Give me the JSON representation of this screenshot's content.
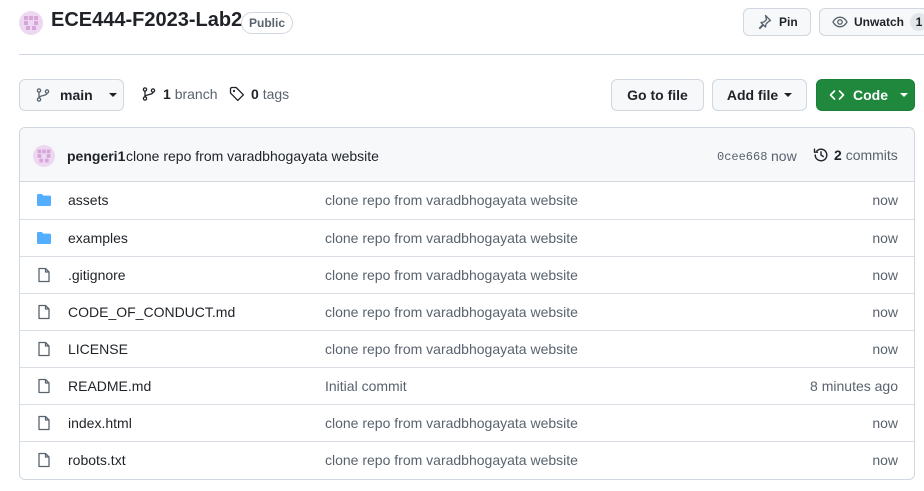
{
  "repo": {
    "name": "ECE444-F2023-Lab2",
    "visibility": "Public",
    "avatar_icon": "identicon-avatar",
    "avatar_color": "#d6a6d8"
  },
  "header_actions": {
    "pin_label": "Pin",
    "pin_icon": "pin-icon",
    "watch_label": "Unwatch",
    "watch_icon": "eye-icon",
    "watch_count": "1"
  },
  "toolbar": {
    "branch_name": "main",
    "branches_count": "1",
    "branches_label": "branch",
    "tags_count": "0",
    "tags_label": "tags",
    "goto_label": "Go to file",
    "addfile_label": "Add file",
    "code_label": "Code",
    "code_color": "#1f883d"
  },
  "latest_commit": {
    "author": "pengeri1",
    "message": "clone repo from varadbhogayata website",
    "sha": "0cee668",
    "time": "now",
    "commits_count": "2",
    "commits_label": "commits"
  },
  "files": [
    {
      "type": "folder",
      "icon": "folder-icon",
      "name": "assets",
      "message": "clone repo from varadbhogayata website",
      "time": "now"
    },
    {
      "type": "folder",
      "icon": "folder-icon",
      "name": "examples",
      "message": "clone repo from varadbhogayata website",
      "time": "now"
    },
    {
      "type": "file",
      "icon": "file-icon",
      "name": ".gitignore",
      "message": "clone repo from varadbhogayata website",
      "time": "now"
    },
    {
      "type": "file",
      "icon": "file-icon",
      "name": "CODE_OF_CONDUCT.md",
      "message": "clone repo from varadbhogayata website",
      "time": "now"
    },
    {
      "type": "file",
      "icon": "file-icon",
      "name": "LICENSE",
      "message": "clone repo from varadbhogayata website",
      "time": "now"
    },
    {
      "type": "file",
      "icon": "file-icon",
      "name": "README.md",
      "message": "Initial commit",
      "time": "8 minutes ago"
    },
    {
      "type": "file",
      "icon": "file-icon",
      "name": "index.html",
      "message": "clone repo from varadbhogayata website",
      "time": "now"
    },
    {
      "type": "file",
      "icon": "file-icon",
      "name": "robots.txt",
      "message": "clone repo from varadbhogayata website",
      "time": "now"
    }
  ],
  "colors": {
    "folder": "#54aeff",
    "muted_text": "#59636e",
    "border": "#d0d7de"
  }
}
